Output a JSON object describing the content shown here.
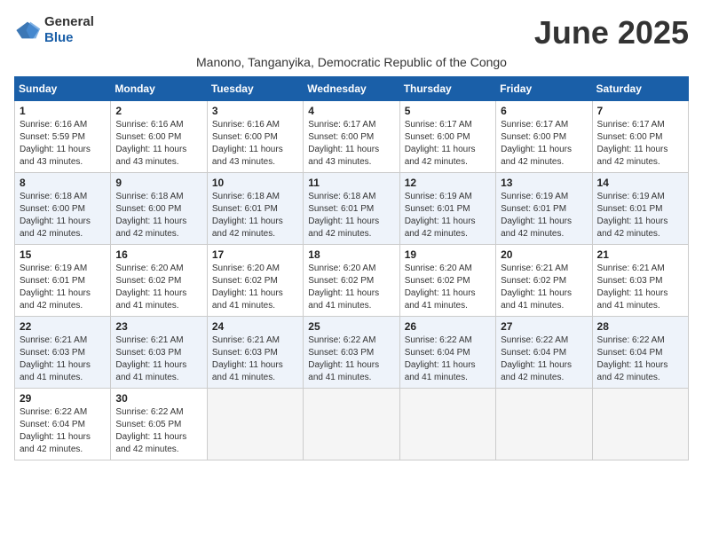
{
  "header": {
    "logo_general": "General",
    "logo_blue": "Blue",
    "month_title": "June 2025",
    "subtitle": "Manono, Tanganyika, Democratic Republic of the Congo"
  },
  "weekdays": [
    "Sunday",
    "Monday",
    "Tuesday",
    "Wednesday",
    "Thursday",
    "Friday",
    "Saturday"
  ],
  "weeks": [
    [
      {
        "day": "1",
        "sunrise": "Sunrise: 6:16 AM",
        "sunset": "Sunset: 5:59 PM",
        "daylight": "Daylight: 11 hours and 43 minutes."
      },
      {
        "day": "2",
        "sunrise": "Sunrise: 6:16 AM",
        "sunset": "Sunset: 6:00 PM",
        "daylight": "Daylight: 11 hours and 43 minutes."
      },
      {
        "day": "3",
        "sunrise": "Sunrise: 6:16 AM",
        "sunset": "Sunset: 6:00 PM",
        "daylight": "Daylight: 11 hours and 43 minutes."
      },
      {
        "day": "4",
        "sunrise": "Sunrise: 6:17 AM",
        "sunset": "Sunset: 6:00 PM",
        "daylight": "Daylight: 11 hours and 43 minutes."
      },
      {
        "day": "5",
        "sunrise": "Sunrise: 6:17 AM",
        "sunset": "Sunset: 6:00 PM",
        "daylight": "Daylight: 11 hours and 42 minutes."
      },
      {
        "day": "6",
        "sunrise": "Sunrise: 6:17 AM",
        "sunset": "Sunset: 6:00 PM",
        "daylight": "Daylight: 11 hours and 42 minutes."
      },
      {
        "day": "7",
        "sunrise": "Sunrise: 6:17 AM",
        "sunset": "Sunset: 6:00 PM",
        "daylight": "Daylight: 11 hours and 42 minutes."
      }
    ],
    [
      {
        "day": "8",
        "sunrise": "Sunrise: 6:18 AM",
        "sunset": "Sunset: 6:00 PM",
        "daylight": "Daylight: 11 hours and 42 minutes."
      },
      {
        "day": "9",
        "sunrise": "Sunrise: 6:18 AM",
        "sunset": "Sunset: 6:00 PM",
        "daylight": "Daylight: 11 hours and 42 minutes."
      },
      {
        "day": "10",
        "sunrise": "Sunrise: 6:18 AM",
        "sunset": "Sunset: 6:01 PM",
        "daylight": "Daylight: 11 hours and 42 minutes."
      },
      {
        "day": "11",
        "sunrise": "Sunrise: 6:18 AM",
        "sunset": "Sunset: 6:01 PM",
        "daylight": "Daylight: 11 hours and 42 minutes."
      },
      {
        "day": "12",
        "sunrise": "Sunrise: 6:19 AM",
        "sunset": "Sunset: 6:01 PM",
        "daylight": "Daylight: 11 hours and 42 minutes."
      },
      {
        "day": "13",
        "sunrise": "Sunrise: 6:19 AM",
        "sunset": "Sunset: 6:01 PM",
        "daylight": "Daylight: 11 hours and 42 minutes."
      },
      {
        "day": "14",
        "sunrise": "Sunrise: 6:19 AM",
        "sunset": "Sunset: 6:01 PM",
        "daylight": "Daylight: 11 hours and 42 minutes."
      }
    ],
    [
      {
        "day": "15",
        "sunrise": "Sunrise: 6:19 AM",
        "sunset": "Sunset: 6:01 PM",
        "daylight": "Daylight: 11 hours and 42 minutes."
      },
      {
        "day": "16",
        "sunrise": "Sunrise: 6:20 AM",
        "sunset": "Sunset: 6:02 PM",
        "daylight": "Daylight: 11 hours and 41 minutes."
      },
      {
        "day": "17",
        "sunrise": "Sunrise: 6:20 AM",
        "sunset": "Sunset: 6:02 PM",
        "daylight": "Daylight: 11 hours and 41 minutes."
      },
      {
        "day": "18",
        "sunrise": "Sunrise: 6:20 AM",
        "sunset": "Sunset: 6:02 PM",
        "daylight": "Daylight: 11 hours and 41 minutes."
      },
      {
        "day": "19",
        "sunrise": "Sunrise: 6:20 AM",
        "sunset": "Sunset: 6:02 PM",
        "daylight": "Daylight: 11 hours and 41 minutes."
      },
      {
        "day": "20",
        "sunrise": "Sunrise: 6:21 AM",
        "sunset": "Sunset: 6:02 PM",
        "daylight": "Daylight: 11 hours and 41 minutes."
      },
      {
        "day": "21",
        "sunrise": "Sunrise: 6:21 AM",
        "sunset": "Sunset: 6:03 PM",
        "daylight": "Daylight: 11 hours and 41 minutes."
      }
    ],
    [
      {
        "day": "22",
        "sunrise": "Sunrise: 6:21 AM",
        "sunset": "Sunset: 6:03 PM",
        "daylight": "Daylight: 11 hours and 41 minutes."
      },
      {
        "day": "23",
        "sunrise": "Sunrise: 6:21 AM",
        "sunset": "Sunset: 6:03 PM",
        "daylight": "Daylight: 11 hours and 41 minutes."
      },
      {
        "day": "24",
        "sunrise": "Sunrise: 6:21 AM",
        "sunset": "Sunset: 6:03 PM",
        "daylight": "Daylight: 11 hours and 41 minutes."
      },
      {
        "day": "25",
        "sunrise": "Sunrise: 6:22 AM",
        "sunset": "Sunset: 6:03 PM",
        "daylight": "Daylight: 11 hours and 41 minutes."
      },
      {
        "day": "26",
        "sunrise": "Sunrise: 6:22 AM",
        "sunset": "Sunset: 6:04 PM",
        "daylight": "Daylight: 11 hours and 41 minutes."
      },
      {
        "day": "27",
        "sunrise": "Sunrise: 6:22 AM",
        "sunset": "Sunset: 6:04 PM",
        "daylight": "Daylight: 11 hours and 42 minutes."
      },
      {
        "day": "28",
        "sunrise": "Sunrise: 6:22 AM",
        "sunset": "Sunset: 6:04 PM",
        "daylight": "Daylight: 11 hours and 42 minutes."
      }
    ],
    [
      {
        "day": "29",
        "sunrise": "Sunrise: 6:22 AM",
        "sunset": "Sunset: 6:04 PM",
        "daylight": "Daylight: 11 hours and 42 minutes."
      },
      {
        "day": "30",
        "sunrise": "Sunrise: 6:22 AM",
        "sunset": "Sunset: 6:05 PM",
        "daylight": "Daylight: 11 hours and 42 minutes."
      },
      null,
      null,
      null,
      null,
      null
    ]
  ]
}
